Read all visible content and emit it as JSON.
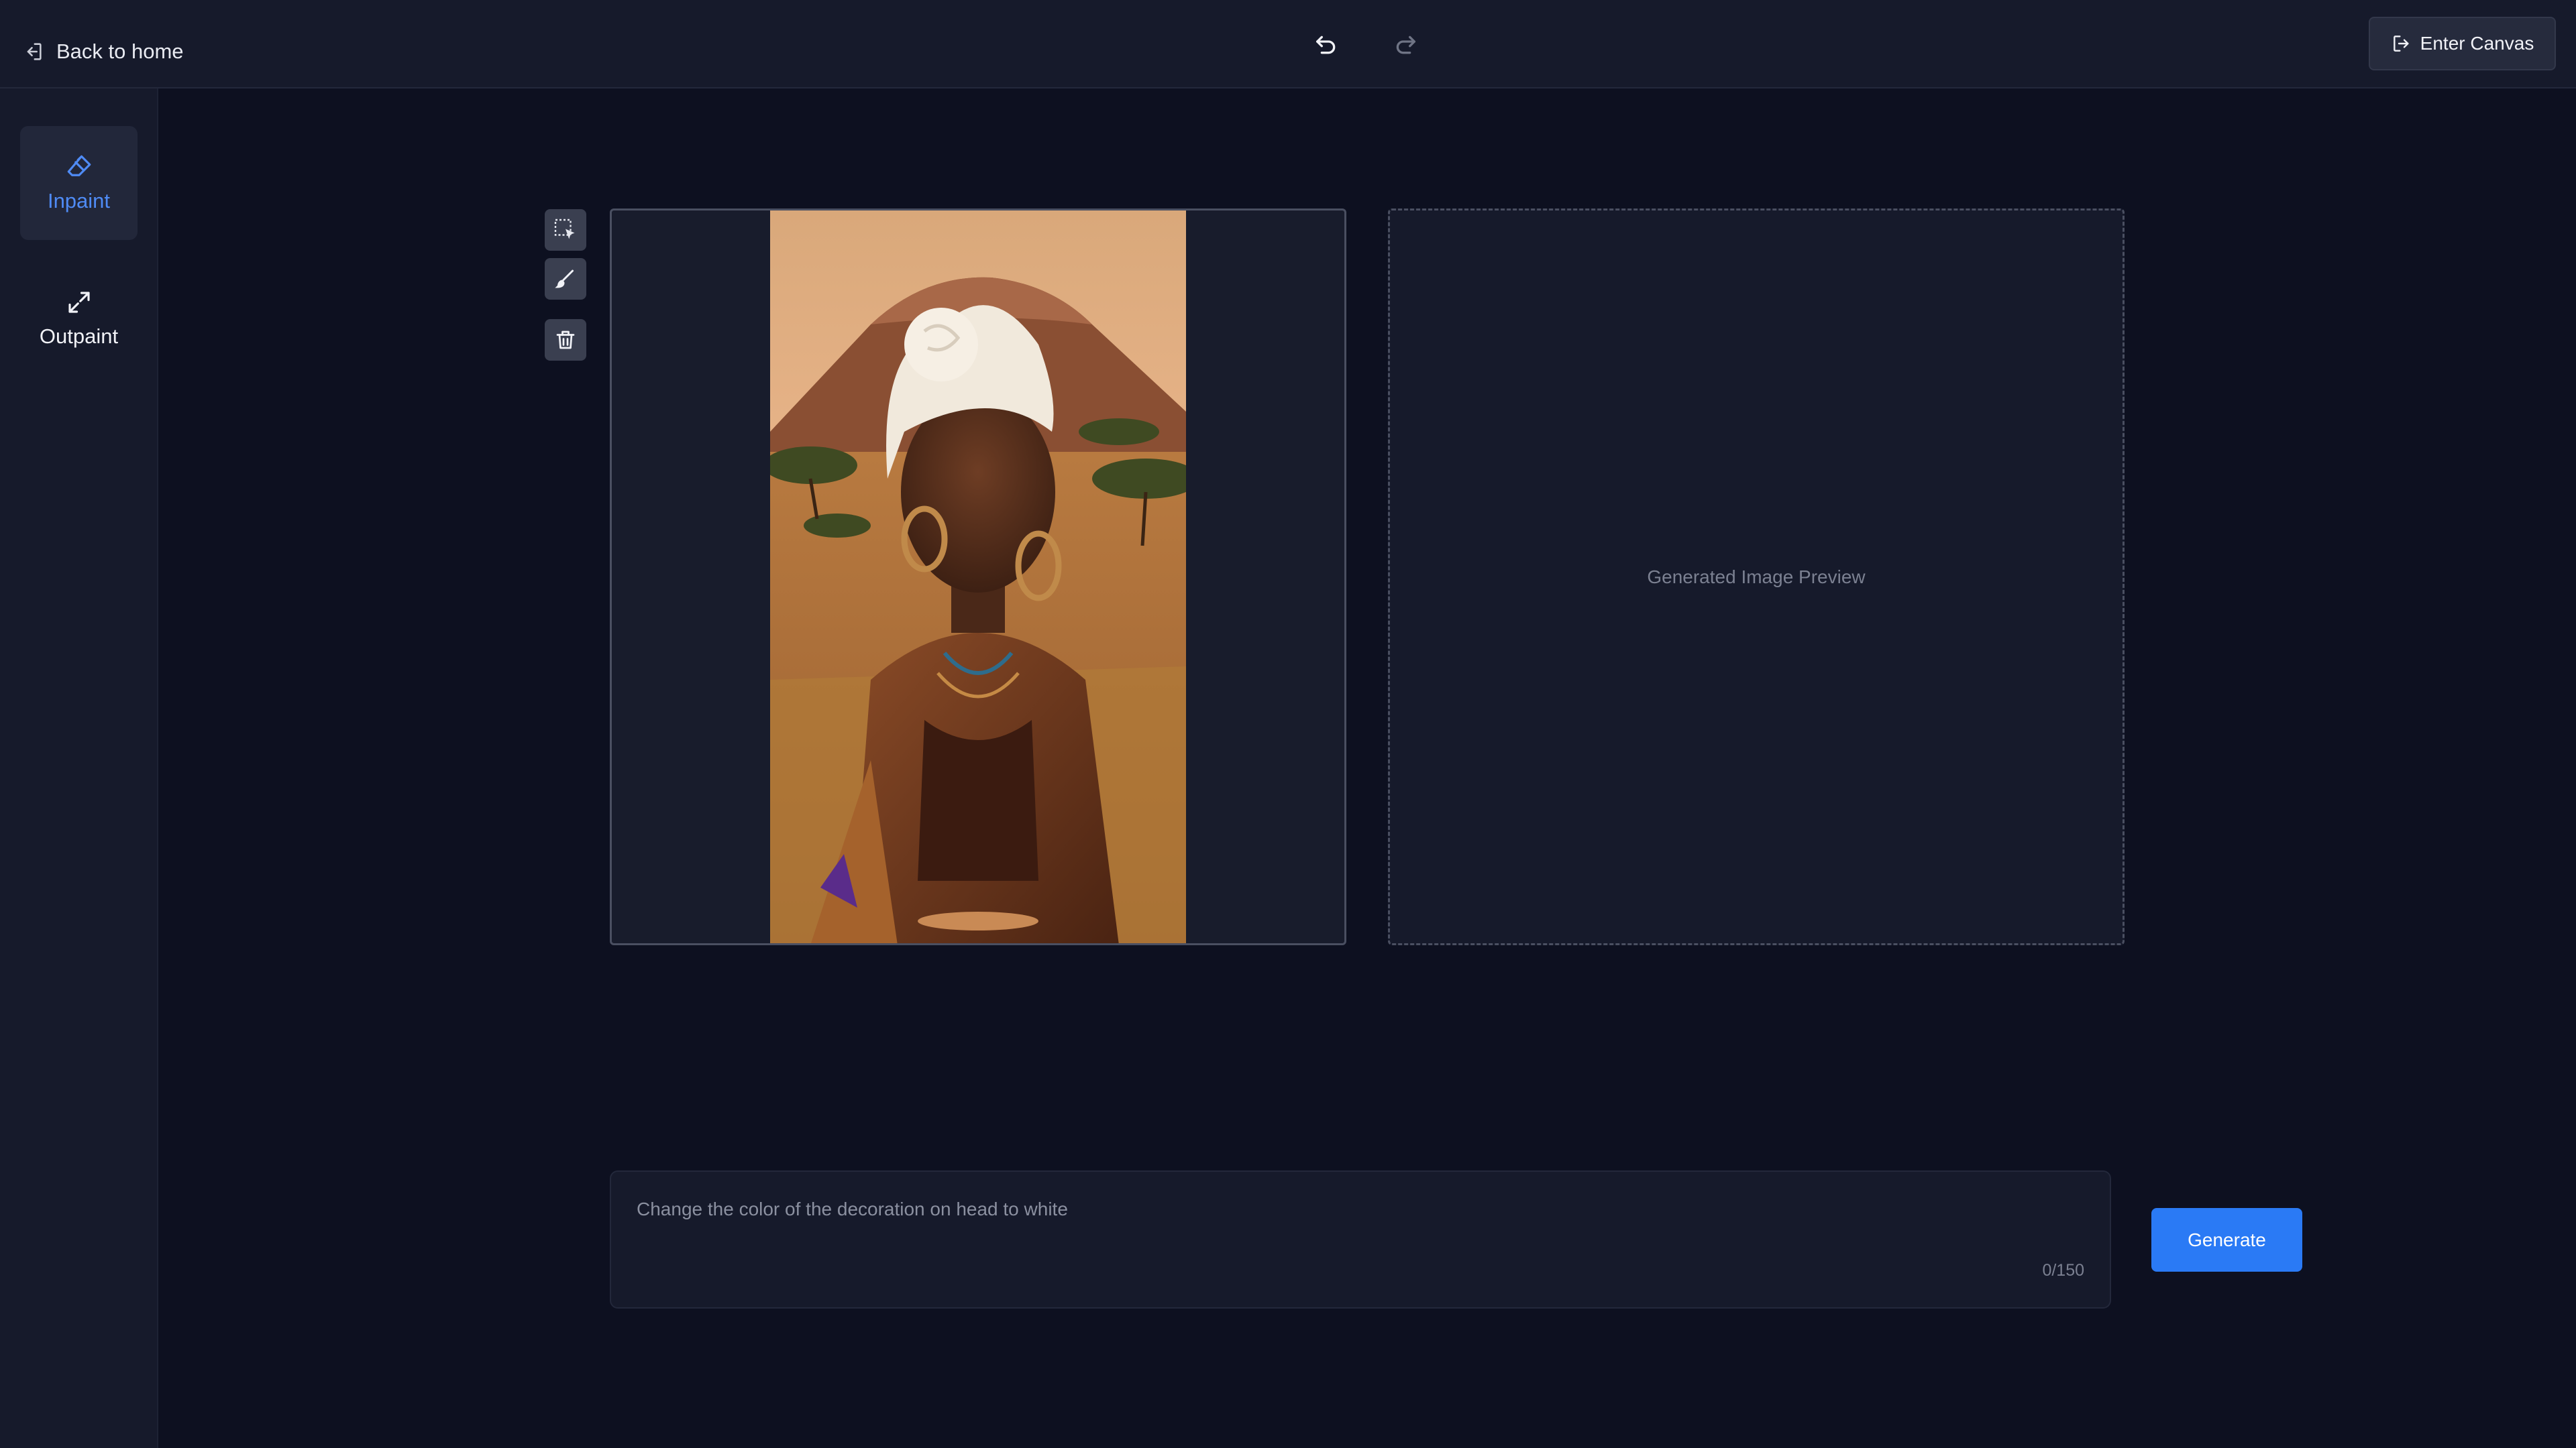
{
  "header": {
    "back_label": "Back to home",
    "enter_canvas_label": "Enter Canvas",
    "icons": {
      "back": "exit-left-icon",
      "undo": "undo-icon",
      "redo": "redo-icon",
      "enter": "exit-right-icon"
    }
  },
  "sidebar": {
    "items": [
      {
        "label": "Inpaint",
        "icon": "brush-eraser-icon",
        "active": true
      },
      {
        "label": "Outpaint",
        "icon": "expand-icon",
        "active": false
      }
    ]
  },
  "tools": [
    {
      "icon": "selection-cursor-icon"
    },
    {
      "icon": "brush-icon"
    },
    {
      "icon": "trash-icon"
    }
  ],
  "editor": {
    "image_alt": "Portrait of a woman in a white head wrap in a savanna landscape"
  },
  "preview": {
    "placeholder": "Generated Image Preview"
  },
  "prompt": {
    "placeholder": "Change the color of the decoration on head to white",
    "value": "",
    "char_count": "0/150"
  },
  "generate_label": "Generate",
  "colors": {
    "accent": "#2a7af5",
    "active_item": "#4f8bf5",
    "background": "#0d1020",
    "panel": "#161a2b"
  }
}
